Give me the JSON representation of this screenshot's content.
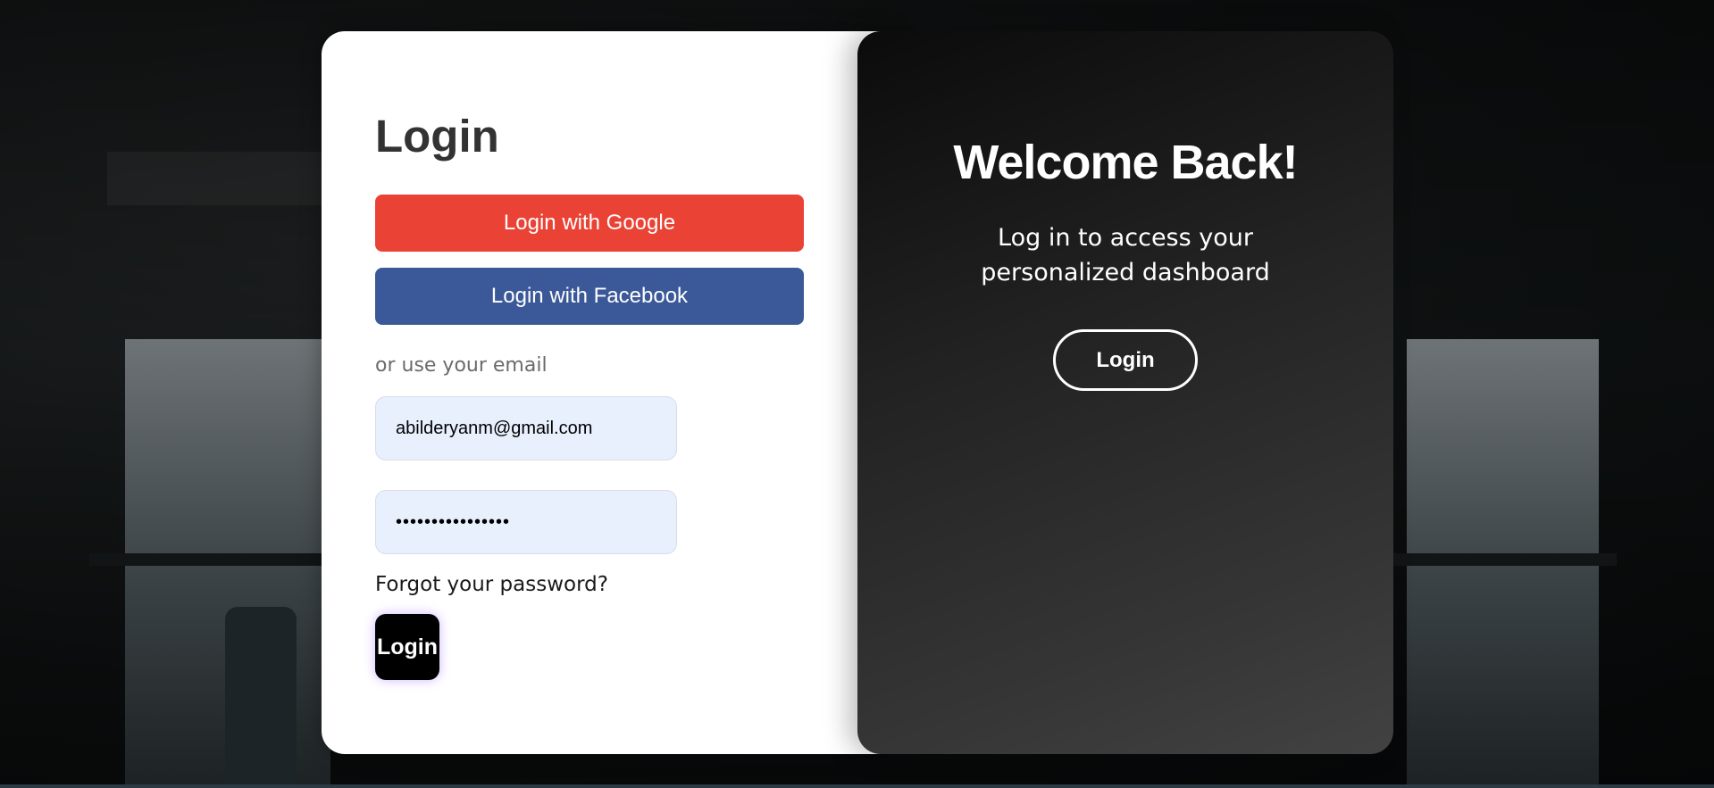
{
  "login_panel": {
    "title": "Login",
    "google_button": "Login with Google",
    "facebook_button": "Login with Facebook",
    "divider_text": "or use your email",
    "email_value": "abilderyanm@gmail.com",
    "password_value": "••••••••••••••••",
    "forgot_link": "Forgot your password?",
    "submit_button": "Login"
  },
  "welcome_panel": {
    "title": "Welcome Back!",
    "subtitle_line1": "Log in to access your",
    "subtitle_line2": "personalized dashboard",
    "login_button": "Login"
  },
  "colors": {
    "google": "#ea4335",
    "facebook": "#3b5998",
    "input_bg": "#e8f0fe",
    "welcome_bg_start": "#0b0b0b",
    "welcome_bg_end": "#424242"
  }
}
